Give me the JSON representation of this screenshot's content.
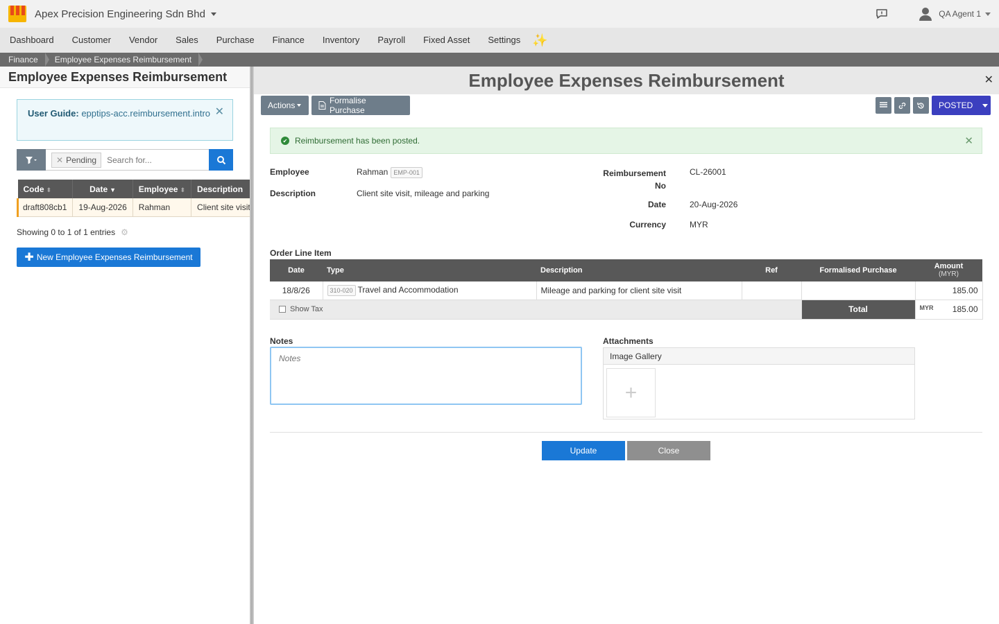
{
  "header": {
    "company": "Apex Precision Engineering Sdn Bhd",
    "user": "QA Agent 1"
  },
  "menu": [
    "Dashboard",
    "Customer",
    "Vendor",
    "Sales",
    "Purchase",
    "Finance",
    "Inventory",
    "Payroll",
    "Fixed Asset",
    "Settings"
  ],
  "breadcrumb": [
    "Finance",
    "Employee Expenses Reimbursement"
  ],
  "left": {
    "title": "Employee Expenses Reimbursement",
    "guide_label": "User Guide:",
    "guide_text": "epptips-acc.reimbursement.intro",
    "filter_chip": "Pending",
    "search_placeholder": "Search for...",
    "columns": [
      "Code",
      "Date",
      "Employee",
      "Description"
    ],
    "rows": [
      {
        "code": "draft808cb1",
        "date": "19-Aug-2026",
        "employee": "Rahman",
        "description": "Client site visit, mileage and parking"
      }
    ],
    "showing": "Showing 0 to 1 of 1 entries",
    "new_button": "New Employee Expenses Reimbursement"
  },
  "detail": {
    "title": "Employee Expenses Reimbursement",
    "actions_label": "Actions",
    "formalise_label": "Formalise Purchase",
    "status": "POSTED",
    "alert": "Reimbursement has been posted.",
    "employee_label": "Employee",
    "employee": "Rahman",
    "employee_code": "EMP-001",
    "description_label": "Description",
    "description": "Client site visit, mileage and parking",
    "reimb_no_label": "Reimbursement No",
    "reimb_no": "CL-26001",
    "date_label": "Date",
    "date": "20-Aug-2026",
    "currency_label": "Currency",
    "currency": "MYR",
    "order_title": "Order Line Item",
    "order_columns": {
      "date": "Date",
      "type": "Type",
      "description": "Description",
      "ref": "Ref",
      "formalised": "Formalised Purchase",
      "amount": "Amount",
      "amount_unit": "(MYR)"
    },
    "lines": [
      {
        "date": "18/8/26",
        "type_code": "310-020",
        "type": "Travel and Accommodation",
        "description": "Mileage and parking for client site visit",
        "ref": "",
        "formalised": "",
        "amount": "185.00"
      }
    ],
    "show_tax": "Show Tax",
    "total_label": "Total",
    "total_currency": "MYR",
    "total": "185.00",
    "notes_label": "Notes",
    "notes_placeholder": "Notes",
    "attachments_label": "Attachments",
    "gallery_label": "Image Gallery",
    "update_label": "Update",
    "close_label": "Close"
  }
}
